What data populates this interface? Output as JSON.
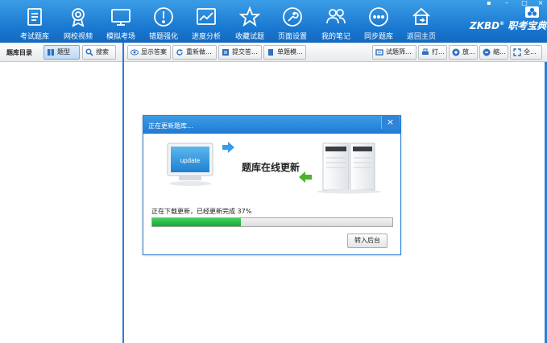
{
  "nav": {
    "items": [
      {
        "label": "考试题库",
        "icon": "document-icon"
      },
      {
        "label": "网校视频",
        "icon": "medal-icon"
      },
      {
        "label": "模拟考场",
        "icon": "monitor-icon"
      },
      {
        "label": "错题强化",
        "icon": "alert-icon"
      },
      {
        "label": "进度分析",
        "icon": "chart-icon"
      },
      {
        "label": "收藏试题",
        "icon": "star-icon"
      },
      {
        "label": "页面设置",
        "icon": "wrench-icon"
      },
      {
        "label": "我的笔记",
        "icon": "people-icon"
      },
      {
        "label": "同步题库",
        "icon": "sync-icon"
      },
      {
        "label": "返回主页",
        "icon": "home-icon"
      }
    ],
    "brand": {
      "prefix": "ZKBD",
      "reg": "®",
      "name": "职考宝典"
    }
  },
  "left": {
    "title": "题库目录",
    "buttons": [
      {
        "label": "题型",
        "icon": "book-icon",
        "active": true
      },
      {
        "label": "搜索",
        "icon": "search-icon",
        "active": false
      }
    ]
  },
  "toolbar": {
    "left_buttons": [
      {
        "label": "显示答案",
        "icon": "eye-icon"
      },
      {
        "label": "重新做...",
        "icon": "refresh-icon"
      },
      {
        "label": "提交答...",
        "icon": "submit-icon"
      },
      {
        "label": "单题模...",
        "icon": "page-icon"
      }
    ],
    "right_buttons": [
      {
        "label": "试题筛...",
        "icon": "filter-icon"
      },
      {
        "label": "打...",
        "icon": "print-icon"
      },
      {
        "label": "放...",
        "icon": "zoom-in-icon"
      },
      {
        "label": "缩...",
        "icon": "zoom-out-icon"
      },
      {
        "label": "全...",
        "icon": "fullscreen-icon"
      }
    ]
  },
  "dialog": {
    "title": "正在更新题库...",
    "banner_text": "题库在线更新",
    "update_label": "update",
    "status": "正在下载更新，已经更新完成 37%",
    "progress_fraction": 0.37,
    "background_button": "转入后台",
    "close": "×"
  },
  "colors": {
    "accent_blue": "#1f7bd3",
    "progress_green": "#1db53c"
  }
}
